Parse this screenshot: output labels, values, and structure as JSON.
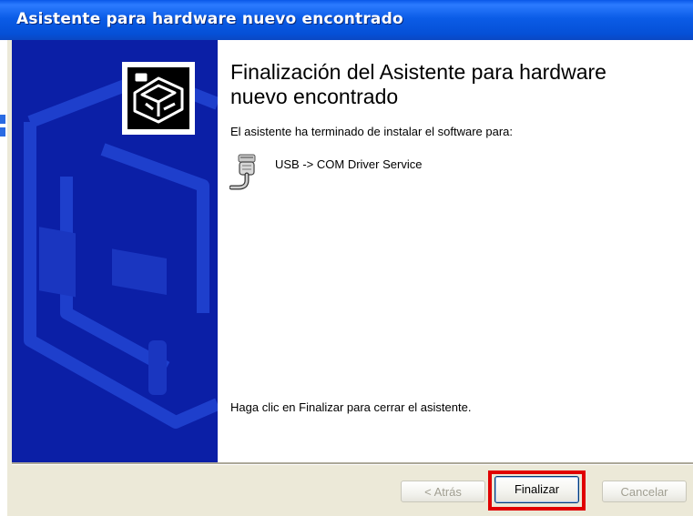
{
  "window": {
    "title": "Asistente para hardware nuevo encontrado"
  },
  "content": {
    "heading": "Finalización del Asistente para hardware nuevo encontrado",
    "subtitle": "El asistente ha terminado de instalar el software para:",
    "device_name": "USB -> COM Driver Service",
    "device_icon": "serial-port-icon",
    "finish_hint": "Haga clic en Finalizar para cerrar el asistente."
  },
  "buttons": {
    "back_label": "< Atrás",
    "finish_label": "Finalizar",
    "cancel_label": "Cancelar"
  },
  "colors": {
    "titlebar": "#0A58E8",
    "side_panel": "#0B1FA6",
    "highlight": "#E00000",
    "dialog_bg": "#ECE9D8"
  }
}
